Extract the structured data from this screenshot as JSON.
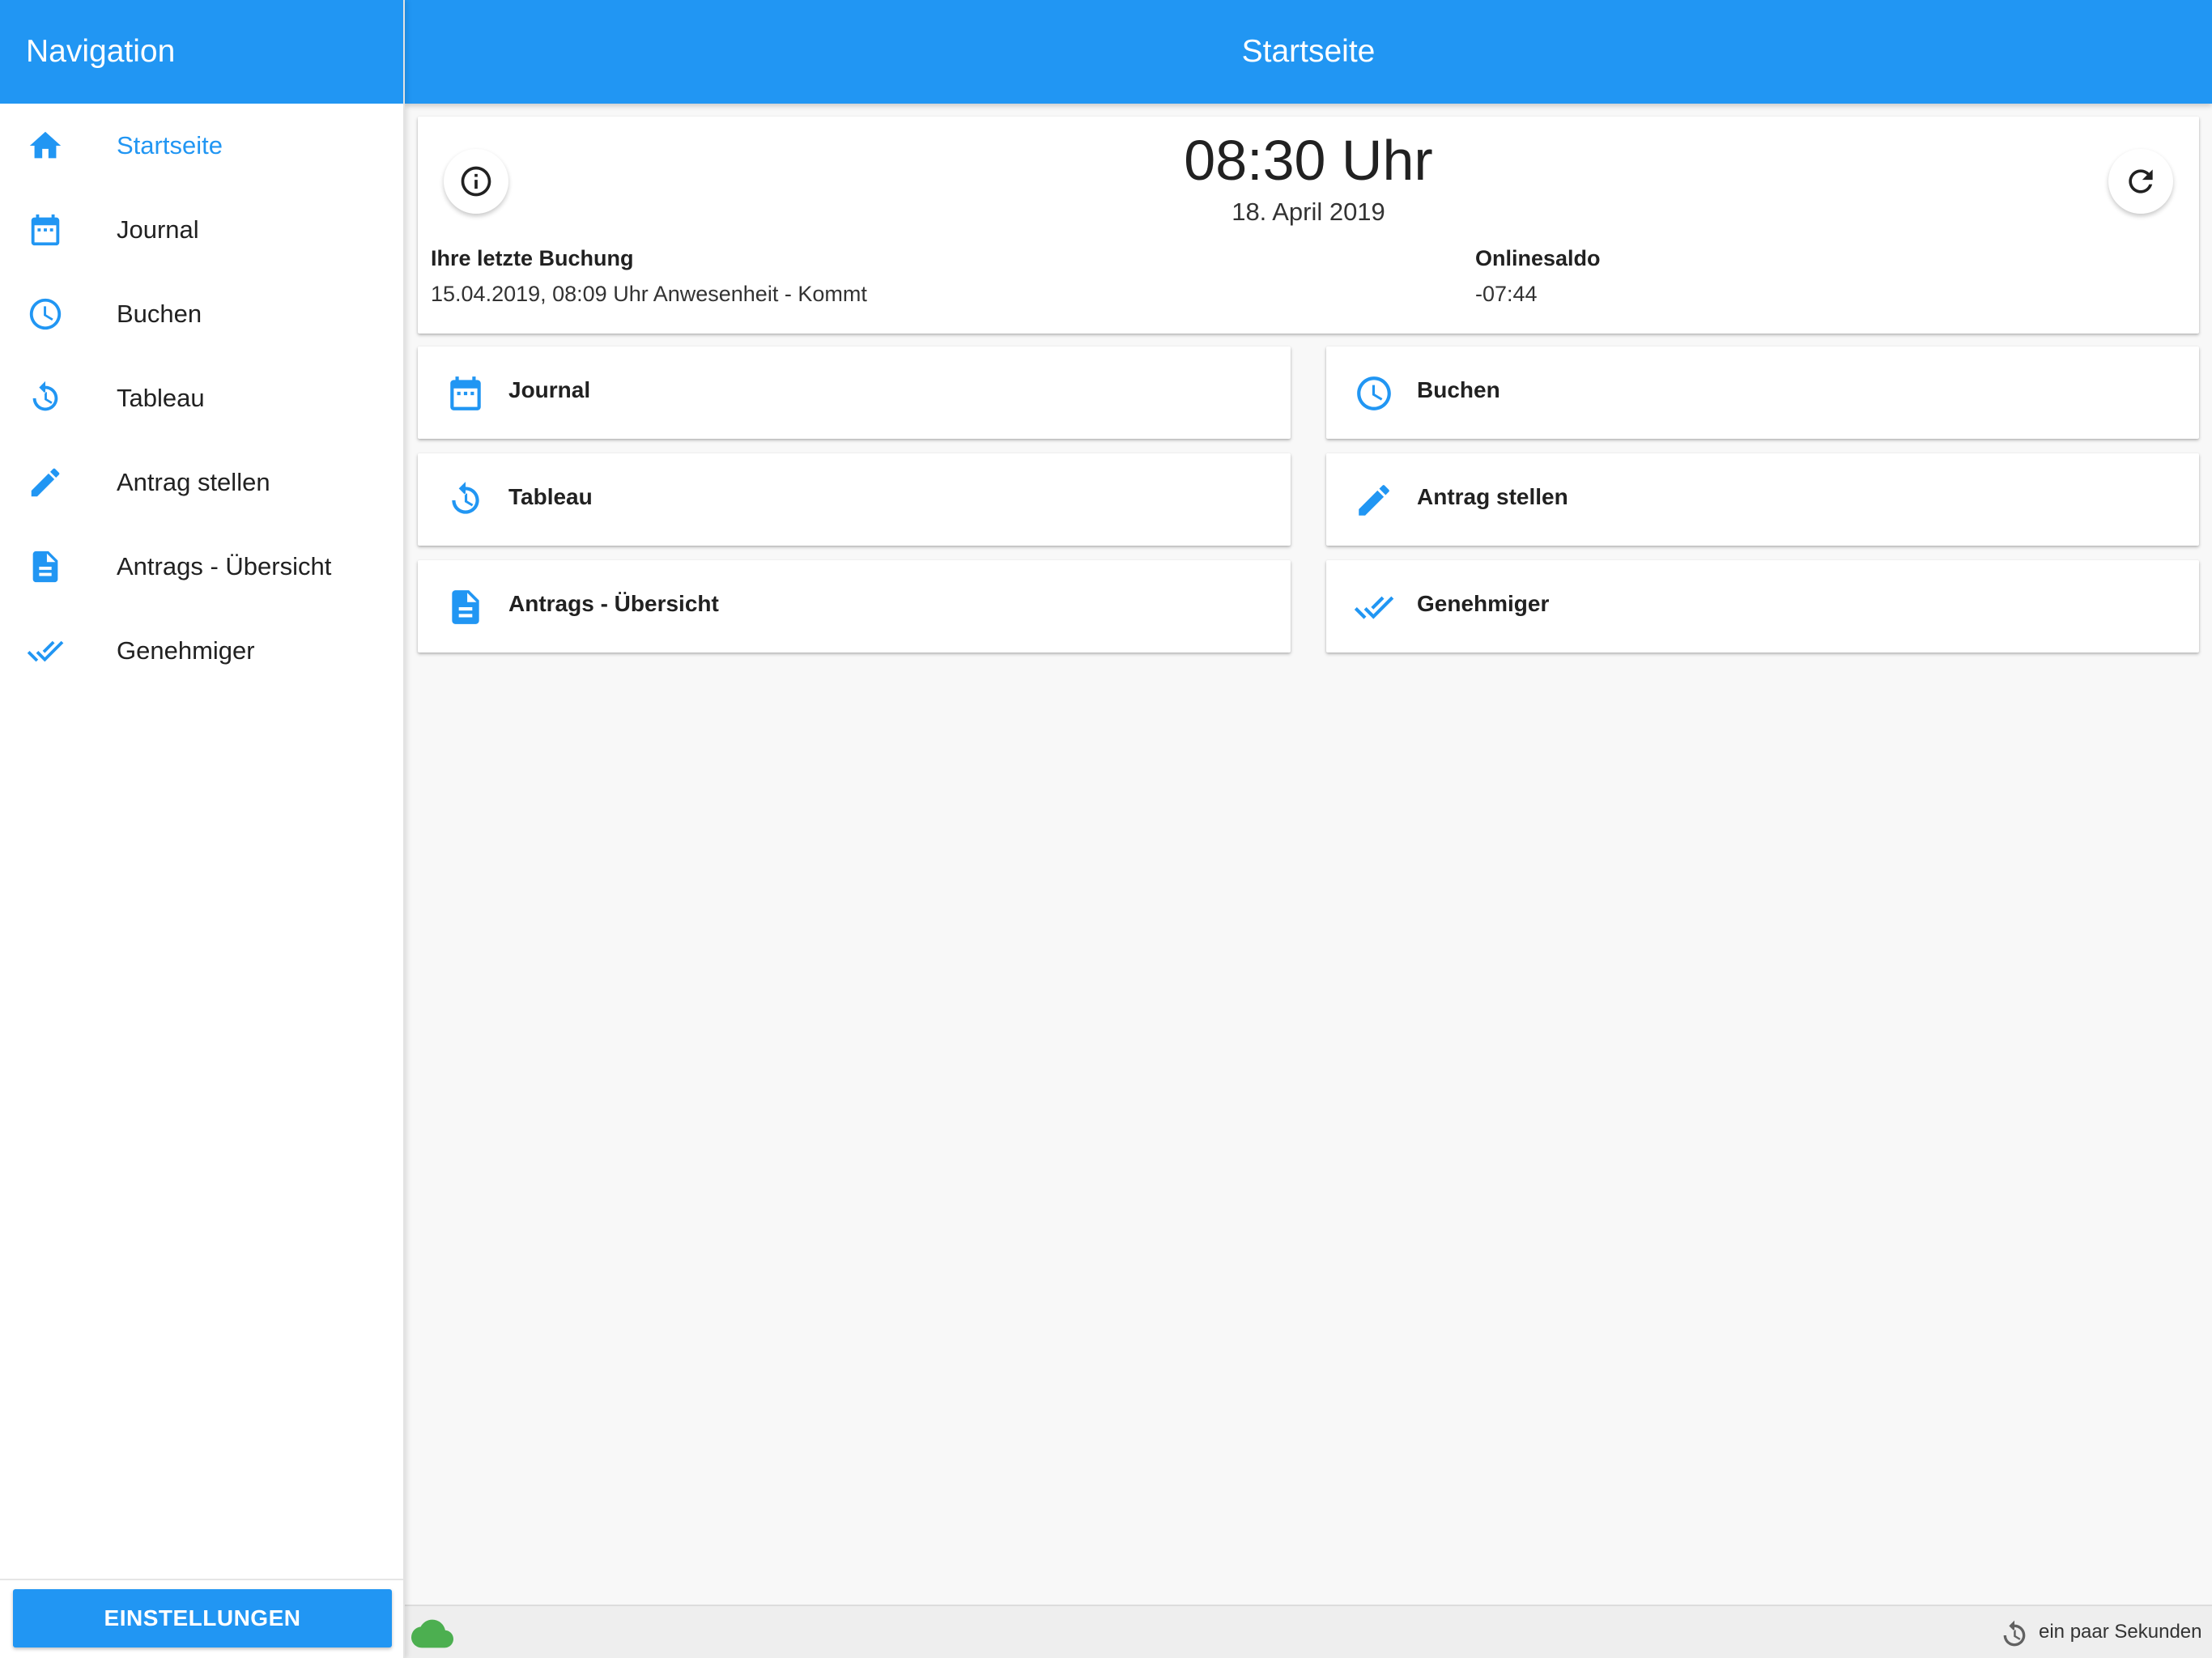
{
  "navigation": {
    "title": "Navigation",
    "items": [
      {
        "label": "Startseite",
        "icon": "home-icon",
        "active": true
      },
      {
        "label": "Journal",
        "icon": "calendar-icon"
      },
      {
        "label": "Buchen",
        "icon": "clock-icon"
      },
      {
        "label": "Tableau",
        "icon": "history-icon"
      },
      {
        "label": "Antrag stellen",
        "icon": "pencil-icon"
      },
      {
        "label": "Antrags - Übersicht",
        "icon": "document-icon"
      },
      {
        "label": "Genehmiger",
        "icon": "double-check-icon"
      }
    ],
    "settings_label": "EINSTELLUNGEN"
  },
  "header": {
    "title": "Startseite"
  },
  "info": {
    "time": "08:30 Uhr",
    "date": "18. April 2019",
    "last_booking_heading": "Ihre letzte Buchung",
    "last_booking_value": "15.04.2019, 08:09 Uhr Anwesenheit - Kommt",
    "saldo_heading": "Onlinesaldo",
    "saldo_value": "-07:44"
  },
  "tiles": [
    {
      "label": "Journal",
      "icon": "calendar-icon"
    },
    {
      "label": "Buchen",
      "icon": "clock-icon"
    },
    {
      "label": "Tableau",
      "icon": "history-icon"
    },
    {
      "label": "Antrag stellen",
      "icon": "pencil-icon"
    },
    {
      "label": "Antrags - Übersicht",
      "icon": "document-icon"
    },
    {
      "label": "Genehmiger",
      "icon": "double-check-icon"
    }
  ],
  "status": {
    "sync_text": "ein paar Sekunden",
    "cloud_icon": "cloud-icon",
    "sync_icon": "history-icon"
  },
  "colors": {
    "primary": "#2196f3",
    "online": "#4caf50",
    "background": "#f8f8f8"
  }
}
